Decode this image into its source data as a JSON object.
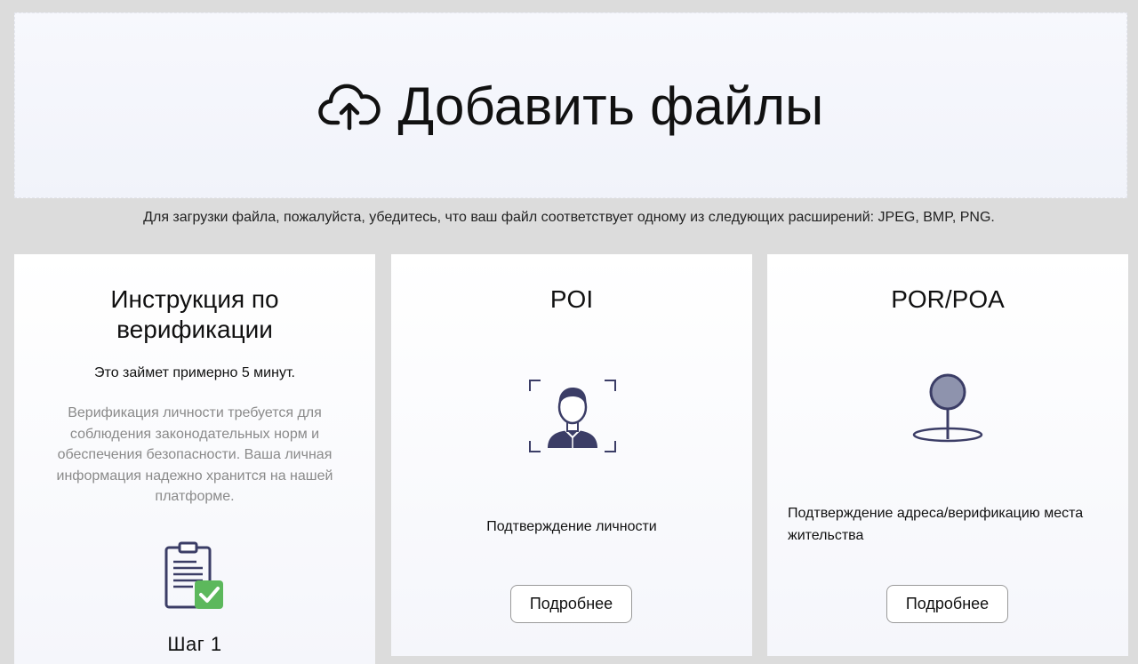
{
  "upload": {
    "title": "Добавить файлы",
    "icon": "cloud-upload-icon"
  },
  "hint": "Для загрузки файла, пожалуйста, убедитесь, что ваш файл соответствует одному из следующих расширений: JPEG, BMP, PNG.",
  "instructions": {
    "title": "Инструкция по верификации",
    "duration": "Это займет примерно 5 минут.",
    "description": "Верификация личности требуется для соблюдения законодательных норм и обеспечения безопасности. Ваша личная информация надежно хранится на нашей платформе.",
    "icon": "clipboard-check-icon",
    "step": "Шаг 1"
  },
  "poi": {
    "title": "POI",
    "icon": "person-frame-icon",
    "label": "Подтверждение личности",
    "button": "Подробнее"
  },
  "por": {
    "title": "POR/POA",
    "icon": "map-pin-icon",
    "label": "Подтверждение адреса/верификацию места жительства",
    "button": "Подробнее"
  },
  "colors": {
    "icon_dark": "#3b3d66",
    "icon_pin_fill": "#8e93ad",
    "check_green": "#5cb85c"
  }
}
